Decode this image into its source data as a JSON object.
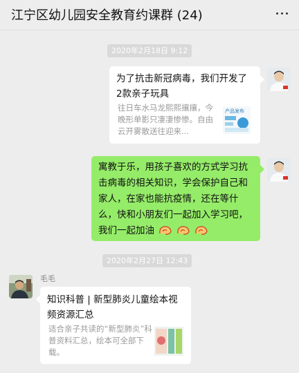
{
  "header": {
    "title": "江宁区幼儿园安全教育约课群 (24)",
    "more_icon": "more-dots-icon"
  },
  "messages": {
    "timestamp_1": "2020年2月18日 9:12",
    "card_1": {
      "title": "为了抗击新冠病毒，我们开发了2款亲子玩具",
      "description": "往日车水马龙熙熙攘攘，今晚形单影只凄凄惨惨。自由云开雾散送往迎来...",
      "thumb_text": "产品发布"
    },
    "text_1": "寓教于乐，用孩子喜欢的方式学习抗击病毒的相关知识，学会保护自己和家人，在家也能抗疫情，还在等什么，快和小朋友们一起加入学习吧，我们一起加油",
    "timestamp_2": "2020年2月27日 12:43",
    "sender_name": "毛毛",
    "card_2": {
      "title": "知识科普 | 新型肺炎儿童绘本视频资源汇总",
      "description": "适合亲子共读的“新型肺炎”科普资料汇总，绘本可全部下载。"
    }
  },
  "colors": {
    "background": "#ededed",
    "my_bubble": "#95ec69",
    "card": "#ffffff",
    "timestamp_bg": "#d9d9d9"
  }
}
